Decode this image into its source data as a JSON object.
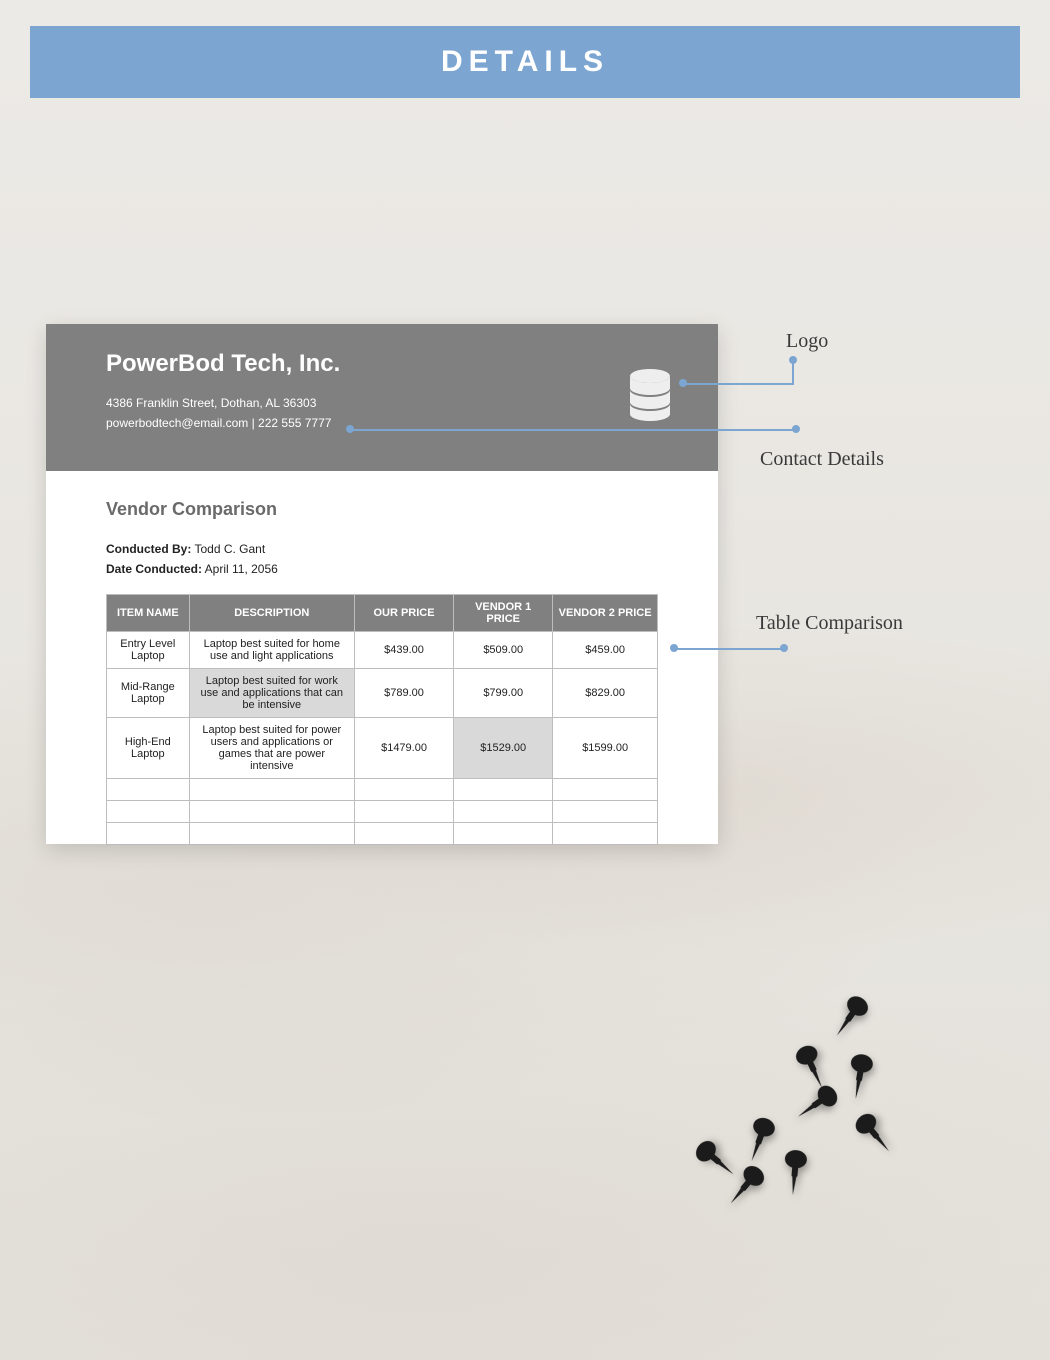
{
  "banner": {
    "title": "DETAILS"
  },
  "doc": {
    "company": "PowerBod Tech, Inc.",
    "address": "4386 Franklin Street, Dothan, AL 36303",
    "contact": "powerbodtech@email.com | 222 555 7777",
    "section_title": "Vendor Comparison",
    "conducted_by_label": "Conducted By:",
    "conducted_by": "Todd C. Gant",
    "date_label": "Date Conducted:",
    "date": "April 11, 2056",
    "headers": {
      "item": "ITEM NAME",
      "desc": "DESCRIPTION",
      "our": "OUR PRICE",
      "v1": "VENDOR 1 PRICE",
      "v2": "VENDOR 2 PRICE"
    },
    "rows": [
      {
        "item": "Entry Level Laptop",
        "desc": "Laptop best suited for home use and light applications",
        "our": "$439.00",
        "v1": "$509.00",
        "v2": "$459.00"
      },
      {
        "item": "Mid-Range Laptop",
        "desc": "Laptop best suited for work use and applications that can be intensive",
        "our": "$789.00",
        "v1": "$799.00",
        "v2": "$829.00"
      },
      {
        "item": "High-End Laptop",
        "desc": "Laptop best suited for power users and applications or games that are power intensive",
        "our": "$1479.00",
        "v1": "$1529.00",
        "v2": "$1599.00"
      }
    ]
  },
  "callouts": {
    "logo": "Logo",
    "contact": "Contact Details",
    "table": "Table Comparison"
  },
  "icons": {
    "logo": "database-icon",
    "pin": "pushpin-icon"
  },
  "colors": {
    "accent": "#7ca6d1",
    "header_gray": "#808080"
  }
}
